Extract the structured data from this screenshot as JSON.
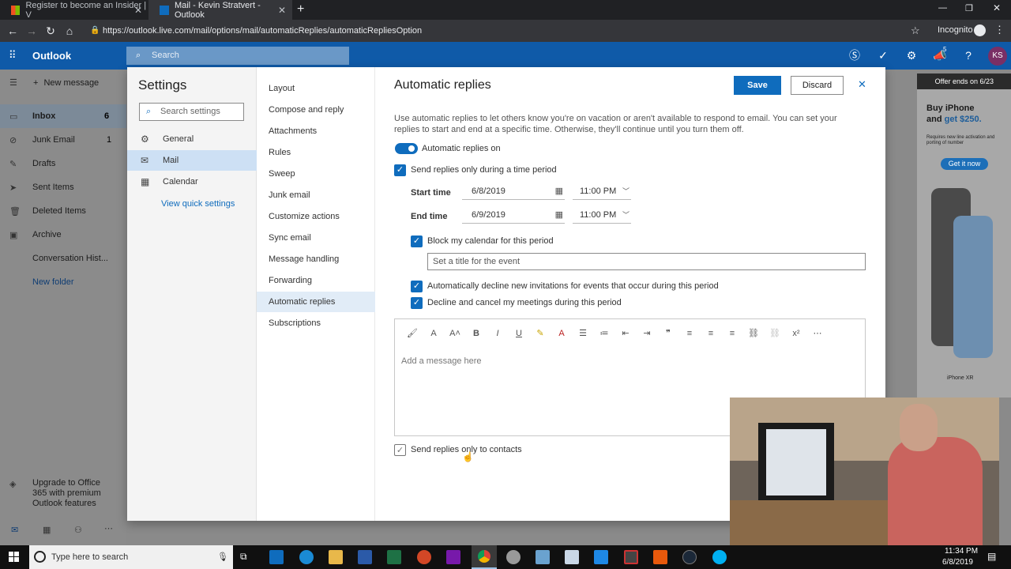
{
  "browser": {
    "tabs": [
      {
        "label": "Register to become an Insider | V",
        "active": false
      },
      {
        "label": "Mail - Kevin Stratvert - Outlook",
        "active": true
      }
    ],
    "url": "https://outlook.live.com/mail/options/mail/automaticReplies/automaticRepliesOption",
    "profile_label": "Incognito"
  },
  "outlook": {
    "app_name": "Outlook",
    "search_placeholder": "Search",
    "notification_count": "5",
    "avatar_initials": "KS"
  },
  "left_nav": {
    "new_message": "New message",
    "folders": [
      {
        "label": "Inbox",
        "count": "6"
      },
      {
        "label": "Junk Email",
        "count": "1"
      },
      {
        "label": "Drafts",
        "count": ""
      },
      {
        "label": "Sent Items",
        "count": ""
      },
      {
        "label": "Deleted Items",
        "count": ""
      },
      {
        "label": "Archive",
        "count": ""
      },
      {
        "label": "Conversation Hist...",
        "count": ""
      }
    ],
    "new_folder": "New folder",
    "upgrade": "Upgrade to Office 365 with premium Outlook features"
  },
  "settings": {
    "title": "Settings",
    "search_placeholder": "Search settings",
    "categories": [
      "General",
      "Mail",
      "Calendar"
    ],
    "view_quick": "View quick settings",
    "mail_items": [
      "Layout",
      "Compose and reply",
      "Attachments",
      "Rules",
      "Sweep",
      "Junk email",
      "Customize actions",
      "Sync email",
      "Message handling",
      "Forwarding",
      "Automatic replies",
      "Subscriptions"
    ]
  },
  "auto": {
    "title": "Automatic replies",
    "save": "Save",
    "discard": "Discard",
    "description": "Use automatic replies to let others know you're on vacation or aren't available to respond to email. You can set your replies to start and end at a specific time. Otherwise, they'll continue until you turn them off.",
    "toggle_label": "Automatic replies on",
    "time_period_label": "Send replies only during a time period",
    "start_label": "Start time",
    "start_date": "6/8/2019",
    "start_time": "11:00 PM",
    "end_label": "End time",
    "end_date": "6/9/2019",
    "end_time": "11:00 PM",
    "block_calendar": "Block my calendar for this period",
    "event_title_placeholder": "Set a title for the event",
    "auto_decline": "Automatically decline new invitations for events that occur during this period",
    "decline_cancel": "Decline and cancel my meetings during this period",
    "message_placeholder": "Add a message here",
    "contacts_only": "Send replies only to contacts"
  },
  "ad": {
    "offer": "Offer ends on 6/23",
    "headline_1": "Buy iPhone",
    "headline_2": "and ",
    "headline_3": "get $250.",
    "fine_print": "Requires new line activation and porting of number",
    "cta": "Get it now",
    "brand": "iPhone XR"
  },
  "taskbar": {
    "search_placeholder": "Type here to search",
    "time": "11:34 PM",
    "date": "6/8/2019"
  }
}
